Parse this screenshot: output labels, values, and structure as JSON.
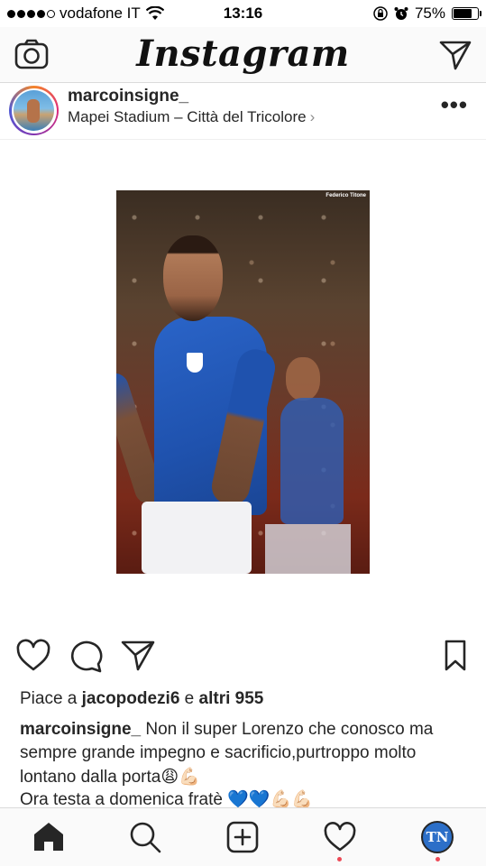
{
  "status_bar": {
    "carrier": "vodafone IT",
    "time": "13:16",
    "battery_percent": "75%",
    "battery_level": 0.75,
    "signal_bars_filled": 4,
    "signal_bars_total": 5
  },
  "nav": {
    "logo_text": "Instagram"
  },
  "post": {
    "username": "marcoinsigne_",
    "location": "Mapei Stadium – Città del Tricolore",
    "photo_credit": "Federico Titone",
    "likes_prefix": "Piace a ",
    "likes_user": "jacopodezi6",
    "likes_middle": " e ",
    "likes_others": "altri 955",
    "caption_user": "marcoinsigne_",
    "caption_text": "Non il super Lorenzo che conosco ma sempre grande impegno e sacrificio,purtroppo molto lontano dalla porta",
    "caption_emojis": "😩💪🏻",
    "caption_line2": "Ora testa a domenica fratè",
    "caption_line2_emojis": "💙💙💪🏻💪🏻"
  },
  "tab_bar": {
    "profile_initials": "TN"
  },
  "colors": {
    "accent_notification": "#ed4956",
    "text": "#262626",
    "border": "#dbdbdb"
  },
  "icons": [
    "camera-icon",
    "send-icon",
    "more-icon",
    "heart-icon",
    "comment-icon",
    "share-icon",
    "bookmark-icon",
    "home-icon",
    "search-icon",
    "add-icon",
    "activity-icon"
  ]
}
